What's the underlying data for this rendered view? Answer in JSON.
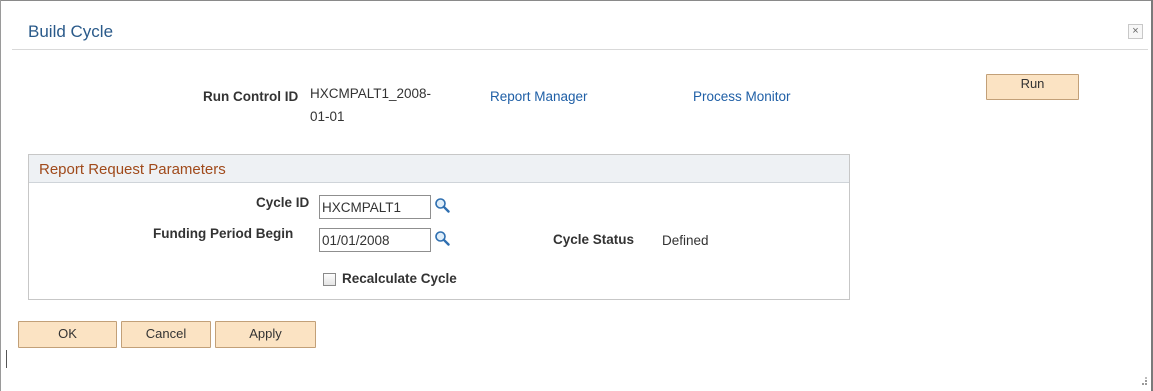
{
  "dialog": {
    "title": "Build Cycle",
    "close_glyph": "×"
  },
  "header": {
    "run_control_label": "Run Control ID",
    "run_control_value_line1": "HXCMPALT1_2008-",
    "run_control_value_line2": "01-01",
    "report_manager_link": "Report Manager",
    "process_monitor_link": "Process Monitor",
    "run_button": "Run"
  },
  "report_params": {
    "title": "Report Request Parameters",
    "cycle_id_label": "Cycle ID",
    "cycle_id_value": "HXCMPALT1",
    "funding_period_label": "Funding Period Begin",
    "funding_period_value": "01/01/2008",
    "cycle_status_label": "Cycle Status",
    "cycle_status_value": "Defined",
    "recalculate_label": "Recalculate Cycle",
    "recalculate_checked": false
  },
  "footer": {
    "ok": "OK",
    "cancel": "Cancel",
    "apply": "Apply"
  },
  "icons": {
    "lookup": "magnifying-glass-icon",
    "close": "close-icon",
    "resize": "resize-grip-icon"
  },
  "colors": {
    "title_blue": "#2a5a8a",
    "link_blue": "#1f5fa6",
    "button_peach": "#fbe3c3",
    "group_title_orange": "#a04a1b"
  }
}
